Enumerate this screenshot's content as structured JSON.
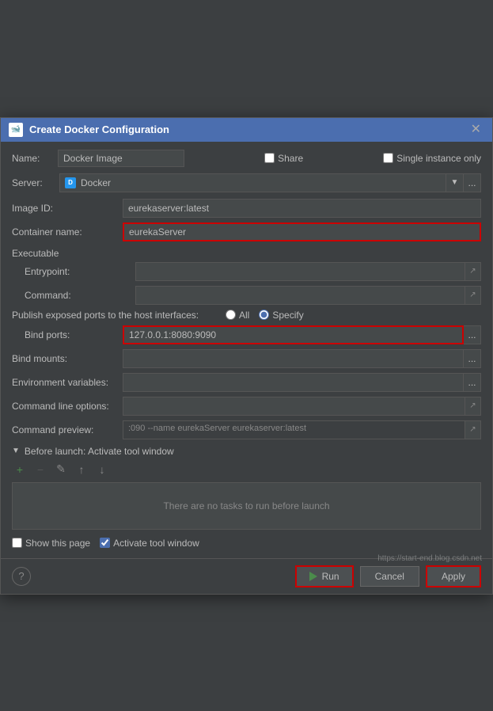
{
  "dialog": {
    "title": "Create Docker Configuration",
    "icon": "🐋"
  },
  "header": {
    "name_label": "Name:",
    "name_value": "Docker Image",
    "share_label": "Share",
    "single_instance_label": "Single instance only"
  },
  "server": {
    "label": "Server:",
    "value": "Docker",
    "dots": "..."
  },
  "image_id": {
    "label": "Image ID:",
    "value": "eurekaserver:latest"
  },
  "container_name": {
    "label": "Container name:",
    "value": "eurekaServer"
  },
  "executable": {
    "section_label": "Executable",
    "entrypoint_label": "Entrypoint:",
    "entrypoint_value": "",
    "command_label": "Command:",
    "command_value": ""
  },
  "ports": {
    "row_label": "Publish exposed ports to the host interfaces:",
    "all_label": "All",
    "specify_label": "Specify",
    "bind_ports_label": "Bind ports:",
    "bind_ports_value": "127.0.0.1:8080:9090",
    "dots": "..."
  },
  "bind_mounts": {
    "label": "Bind mounts:",
    "dots": "..."
  },
  "env_vars": {
    "label": "Environment variables:",
    "dots": "..."
  },
  "cmd_options": {
    "label": "Command line options:",
    "value": ""
  },
  "cmd_preview": {
    "label": "Command preview:",
    "value": ":090 --name eurekaServer eurekaserver:latest"
  },
  "before_launch": {
    "label": "Before launch: Activate tool window",
    "no_tasks_text": "There are no tasks to run before launch"
  },
  "bottom": {
    "show_page_label": "Show this page",
    "activate_tool_label": "Activate tool window"
  },
  "footer": {
    "run_label": "Run",
    "cancel_label": "Cancel",
    "apply_label": "Apply"
  },
  "watermark": "https://start-end.blog.csdn.net"
}
